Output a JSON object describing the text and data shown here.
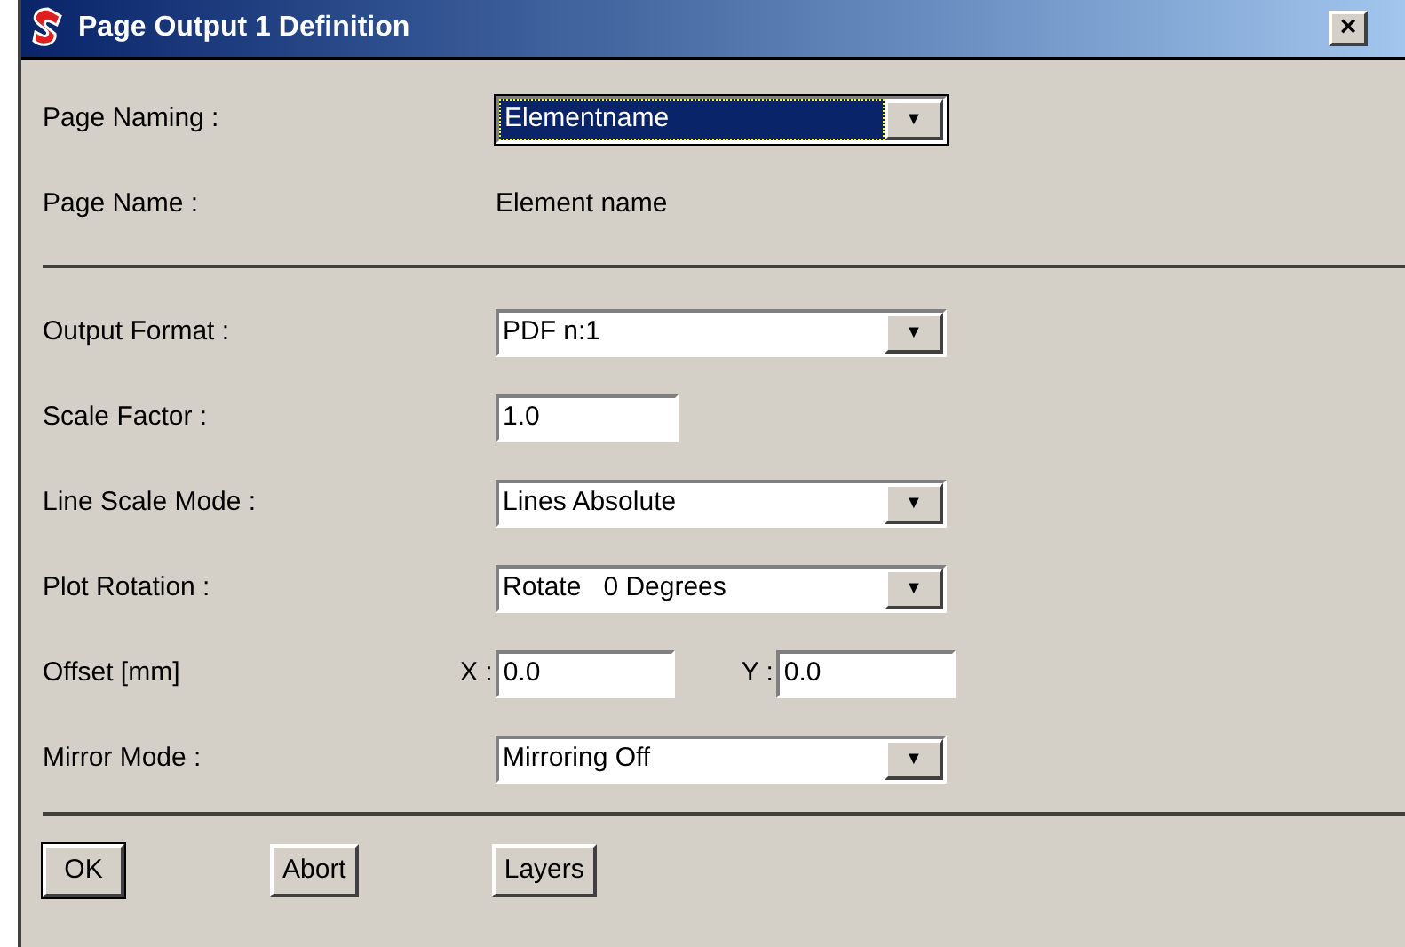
{
  "window": {
    "title": "Page Output 1 Definition",
    "close": "×"
  },
  "top_fields": [
    {
      "kind": "combo",
      "label": "Page Naming :",
      "value": "Elementname",
      "focused": true,
      "arrow": "▼"
    },
    {
      "kind": "text",
      "label": "Page Name :",
      "value": "Element name"
    }
  ],
  "fields": [
    {
      "kind": "combo",
      "label": "Output Format :",
      "value": "PDF n:1",
      "focused": false,
      "arrow": "▼"
    },
    {
      "kind": "input",
      "label": "Scale Factor :",
      "value": "1.0"
    },
    {
      "kind": "combo",
      "label": "Line Scale Mode :",
      "value": "Lines Absolute",
      "focused": false,
      "arrow": "▼"
    },
    {
      "kind": "combo",
      "label": "Plot Rotation :",
      "value": "Rotate   0 Degrees",
      "focused": false,
      "arrow": "▼"
    },
    {
      "kind": "offset",
      "label": "Offset [mm]",
      "x_label": "X :",
      "x_value": "0.0",
      "y_label": "Y :",
      "y_value": "0.0"
    },
    {
      "kind": "combo",
      "label": "Mirror Mode :",
      "value": "Mirroring Off",
      "focused": false,
      "arrow": "▼"
    }
  ],
  "buttons": [
    {
      "label": "OK",
      "default": true
    },
    {
      "label": "Abort",
      "default": false
    },
    {
      "label": "Layers",
      "default": false
    }
  ]
}
